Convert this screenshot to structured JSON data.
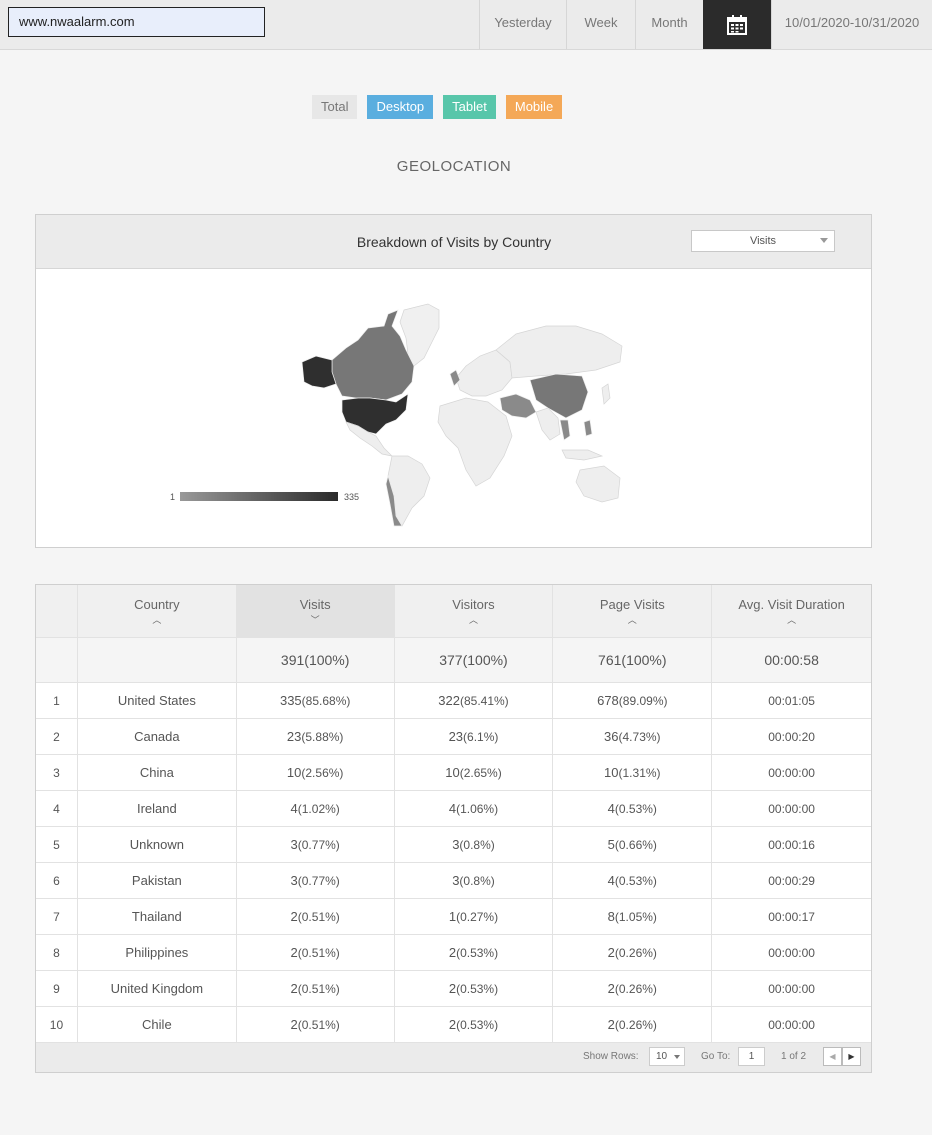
{
  "topbar": {
    "site": "www.nwaalarm.com",
    "ranges": [
      "Yesterday",
      "Week",
      "Month"
    ],
    "calendar_icon": "calendar-icon",
    "date_range": "10/01/2020-10/31/2020"
  },
  "filters": {
    "total": "Total",
    "desktop": "Desktop",
    "tablet": "Tablet",
    "mobile": "Mobile",
    "colors": {
      "total": "#e7e7e7",
      "desktop": "#5aaedf",
      "tablet": "#58c6aa",
      "mobile": "#f4a857"
    }
  },
  "section_title": "GEOLOCATION",
  "map": {
    "title": "Breakdown of Visits by Country",
    "metric": "Visits",
    "legend_min": "1",
    "legend_max": "335"
  },
  "table": {
    "headers": [
      "Country",
      "Visits",
      "Visitors",
      "Page Visits",
      "Avg. Visit Duration"
    ],
    "totals": [
      "391(100%)",
      "377(100%)",
      "761(100%)",
      "00:00:58"
    ],
    "rows": [
      {
        "n": "1",
        "country": "United States",
        "v": "335",
        "vp": "(85.68%)",
        "u": "322",
        "up": "(85.41%)",
        "p": "678",
        "pp": "(89.09%)",
        "d": "00:01:05"
      },
      {
        "n": "2",
        "country": "Canada",
        "v": "23",
        "vp": "(5.88%)",
        "u": "23",
        "up": "(6.1%)",
        "p": "36",
        "pp": "(4.73%)",
        "d": "00:00:20"
      },
      {
        "n": "3",
        "country": "China",
        "v": "10",
        "vp": "(2.56%)",
        "u": "10",
        "up": "(2.65%)",
        "p": "10",
        "pp": "(1.31%)",
        "d": "00:00:00"
      },
      {
        "n": "4",
        "country": "Ireland",
        "v": "4",
        "vp": "(1.02%)",
        "u": "4",
        "up": "(1.06%)",
        "p": "4",
        "pp": "(0.53%)",
        "d": "00:00:00"
      },
      {
        "n": "5",
        "country": "Unknown",
        "v": "3",
        "vp": "(0.77%)",
        "u": "3",
        "up": "(0.8%)",
        "p": "5",
        "pp": "(0.66%)",
        "d": "00:00:16"
      },
      {
        "n": "6",
        "country": "Pakistan",
        "v": "3",
        "vp": "(0.77%)",
        "u": "3",
        "up": "(0.8%)",
        "p": "4",
        "pp": "(0.53%)",
        "d": "00:00:29"
      },
      {
        "n": "7",
        "country": "Thailand",
        "v": "2",
        "vp": "(0.51%)",
        "u": "1",
        "up": "(0.27%)",
        "p": "8",
        "pp": "(1.05%)",
        "d": "00:00:17"
      },
      {
        "n": "8",
        "country": "Philippines",
        "v": "2",
        "vp": "(0.51%)",
        "u": "2",
        "up": "(0.53%)",
        "p": "2",
        "pp": "(0.26%)",
        "d": "00:00:00"
      },
      {
        "n": "9",
        "country": "United Kingdom",
        "v": "2",
        "vp": "(0.51%)",
        "u": "2",
        "up": "(0.53%)",
        "p": "2",
        "pp": "(0.26%)",
        "d": "00:00:00"
      },
      {
        "n": "10",
        "country": "Chile",
        "v": "2",
        "vp": "(0.51%)",
        "u": "2",
        "up": "(0.53%)",
        "p": "2",
        "pp": "(0.26%)",
        "d": "00:00:00"
      }
    ],
    "footer": {
      "show_rows_label": "Show Rows:",
      "show_rows_value": "10",
      "goto_label": "Go To:",
      "goto_value": "1",
      "page_info": "1 of 2"
    }
  }
}
